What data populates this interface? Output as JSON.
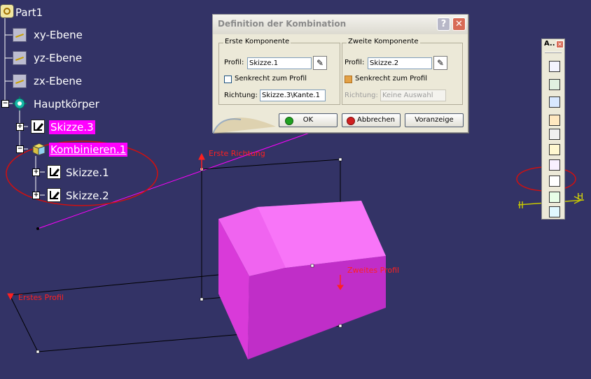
{
  "tree": {
    "root": "Part1",
    "planes": [
      "xy-Ebene",
      "yz-Ebene",
      "zx-Ebene"
    ],
    "body": "Hauptkörper",
    "sketch3": "Skizze.3",
    "combine": "Kombinieren.1",
    "children": [
      "Skizze.1",
      "Skizze.2"
    ]
  },
  "dialog": {
    "title": "Definition der Kombination",
    "first": {
      "group_title": "Erste Komponente",
      "profile_label": "Profil:",
      "profile_value": "Skizze.1",
      "perp_label": "Senkrecht zum Profil",
      "perp_checked": false,
      "dir_label": "Richtung:",
      "dir_value": "Skizze.3\\Kante.1"
    },
    "second": {
      "group_title": "Zweite Komponente",
      "profile_label": "Profil:",
      "profile_value": "Skizze.2",
      "perp_label": "Senkrecht zum Profil",
      "perp_checked": true,
      "dir_label": "Richtung:",
      "dir_value": "Keine Auswahl"
    },
    "buttons": {
      "ok": "OK",
      "cancel": "Abbrechen",
      "preview": "Voranzeige"
    }
  },
  "toolbar": {
    "title": "A.."
  },
  "viewport": {
    "labels": {
      "first_direction": "Erste Richtung",
      "second_profile": "Zweites Profil",
      "first_profile": "Erstes Profil",
      "axis_h": "H"
    }
  },
  "colors": {
    "background": "#333366",
    "highlight": "#ff00ff",
    "solid": "#e030e0",
    "annotation_circle": "#d01010"
  }
}
